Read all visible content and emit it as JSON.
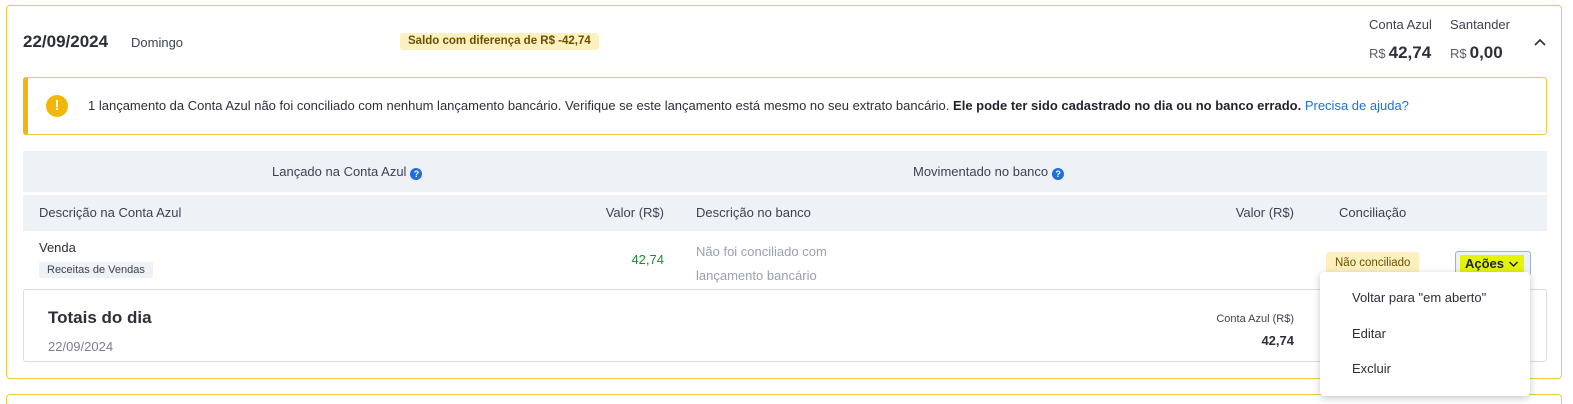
{
  "day": {
    "date": "22/09/2024",
    "weekday": "Domingo",
    "difference_badge": "Saldo com diferença de R$ -42,74"
  },
  "accounts": [
    {
      "name": "Conta Azul",
      "currency": "R$",
      "value": "42,74"
    },
    {
      "name": "Santander",
      "currency": "R$",
      "value": "0,00"
    }
  ],
  "alert": {
    "icon": "warning-icon",
    "message": "1 lançamento da Conta Azul não foi conciliado com nenhum lançamento bancário. Verifique se este lançamento está mesmo no seu extrato bancário.",
    "emphasis": "Ele pode ter sido cadastrado no dia ou no banco errado.",
    "help_link": "Precisa de ajuda?",
    "accent_color": "#f2b705"
  },
  "table": {
    "group_headers": [
      "Lançado na Conta Azul",
      "Movimentado no banco"
    ],
    "columns": [
      "Descrição na Conta Azul",
      "Valor (R$)",
      "Descrição no banco",
      "Valor (R$)",
      "Conciliação"
    ],
    "rows": [
      {
        "description": "Venda",
        "category": "Receitas de Vendas",
        "value": "42,74",
        "bank_description": "Não foi conciliado com lançamento bancário",
        "status": "Não conciliado",
        "actions_label": "Ações"
      }
    ]
  },
  "totals": {
    "title": "Totais do dia",
    "date": "22/09/2024",
    "label": "Conta Azul (R$)",
    "value": "42,74"
  },
  "actions_menu": {
    "items": [
      "Voltar para \"em aberto\"",
      "Editar",
      "Excluir"
    ]
  },
  "colors": {
    "border": "#f2c744",
    "positive": "#1f8a38",
    "link": "#1e6fd9",
    "highlight": "#e3f30a"
  }
}
